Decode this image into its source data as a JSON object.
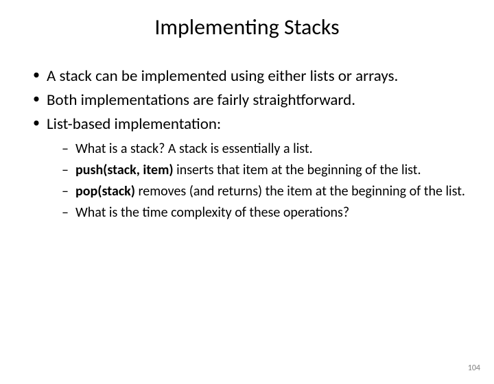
{
  "title": "Implementing Stacks",
  "bullets": {
    "b1": "A stack can be implemented using either lists or arrays.",
    "b2": "Both implementations are fairly straightforward.",
    "b3": "List-based implementation:"
  },
  "sub": {
    "s1": "What is a stack? A stack is essentially a list.",
    "s2a": "push(stack, item)",
    "s2b": " inserts that item at the beginning of the list.",
    "s3a": "pop(stack)",
    "s3b": " removes (and returns) the item at the beginning of the list.",
    "s4": "What is the time complexity of these operations?"
  },
  "page_number": "104"
}
